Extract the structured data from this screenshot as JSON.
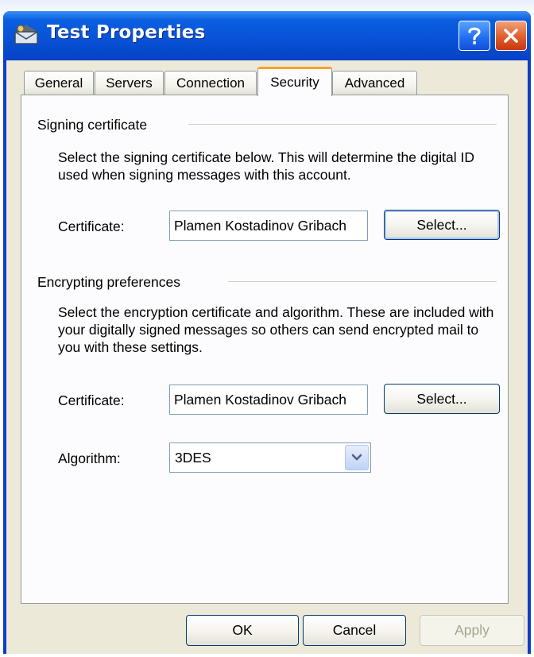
{
  "window": {
    "title": "Test Properties",
    "icon": "envelope-account-icon",
    "help_icon": "question-mark-icon",
    "close_icon": "close-x-icon"
  },
  "tabs": [
    {
      "label": "General",
      "active": false
    },
    {
      "label": "Servers",
      "active": false
    },
    {
      "label": "Connection",
      "active": false
    },
    {
      "label": "Security",
      "active": true
    },
    {
      "label": "Advanced",
      "active": false
    }
  ],
  "signing": {
    "section_title": "Signing certificate",
    "description": "Select the signing certificate below. This will determine the digital ID used when signing messages with this account.",
    "certificate_label": "Certificate:",
    "certificate_value": "Plamen Kostadinov Gribach",
    "select_label": "Select..."
  },
  "encrypting": {
    "section_title": "Encrypting preferences",
    "description": "Select the encryption certificate and algorithm. These are included with your digitally signed messages so others can send encrypted mail to you with these settings.",
    "certificate_label": "Certificate:",
    "certificate_value": "Plamen Kostadinov Gribach",
    "select_label": "Select...",
    "algorithm_label": "Algorithm:",
    "algorithm_value": "3DES"
  },
  "footer": {
    "ok_label": "OK",
    "cancel_label": "Cancel",
    "apply_label": "Apply"
  },
  "colors": {
    "titlebar": "#0954d9",
    "tab_active_accent": "#f6a22a",
    "face": "#ece9d8",
    "close_button": "#e05d2b"
  }
}
